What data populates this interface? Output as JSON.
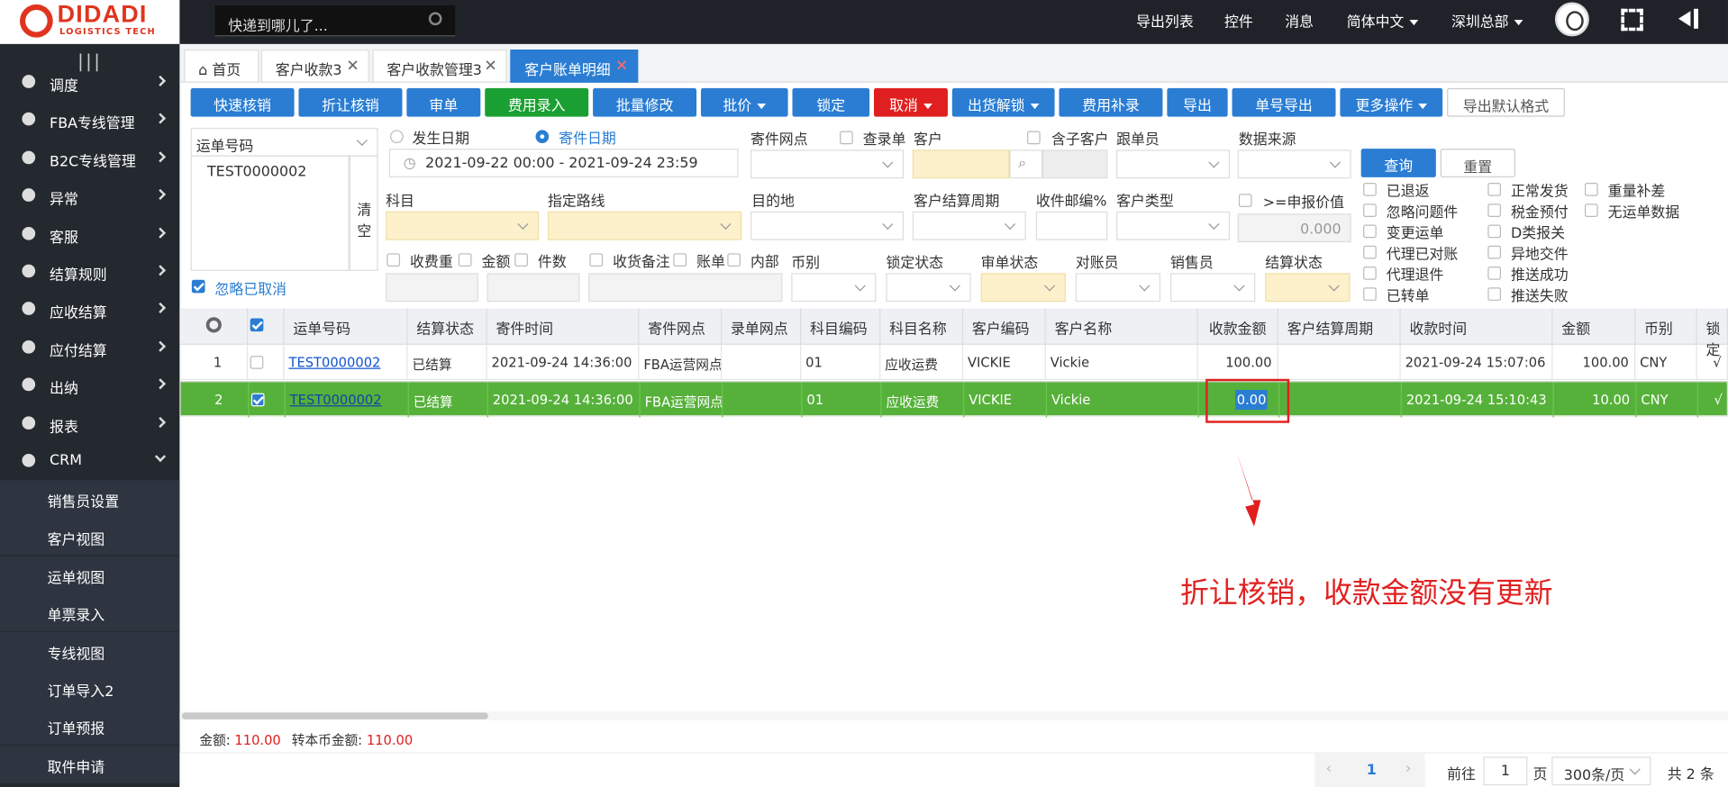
{
  "brand": {
    "name": "DIDADI",
    "tagline": "LOGISTICS TECH"
  },
  "search": {
    "placeholder": "快递到哪儿了..."
  },
  "topnav": {
    "export_list": "导出列表",
    "plugin": "控件",
    "messages": "消息",
    "language": "简体中文",
    "branch": "深圳总部"
  },
  "sidebar": {
    "items": [
      {
        "label": "调度",
        "icon": "dispatch-icon"
      },
      {
        "label": "FBA专线管理",
        "icon": "pie-icon"
      },
      {
        "label": "B2C专线管理",
        "icon": "pie-icon"
      },
      {
        "label": "异常",
        "icon": "alert-icon"
      },
      {
        "label": "客服",
        "icon": "service-icon"
      },
      {
        "label": "结算规则",
        "icon": "rule-icon"
      },
      {
        "label": "应收结算",
        "icon": "truck-icon"
      },
      {
        "label": "应付结算",
        "icon": "truck-icon"
      },
      {
        "label": "出纳",
        "icon": "user-icon"
      },
      {
        "label": "报表",
        "icon": "report-icon"
      },
      {
        "label": "CRM",
        "icon": "crm-icon"
      }
    ],
    "crm_children": [
      "销售员设置",
      "客户视图",
      "运单视图",
      "单票录入",
      "专线视图",
      "订单导入2",
      "订单预报",
      "取件申请"
    ]
  },
  "tabs": [
    {
      "label": "首页"
    },
    {
      "label": "客户收款3"
    },
    {
      "label": "客户收款管理3"
    },
    {
      "label": "客户账单明细"
    }
  ],
  "toolbar": {
    "quick_verify": "快速核销",
    "discount_verify": "折让核销",
    "audit": "审单",
    "fee_entry": "费用录入",
    "batch_edit": "批量修改",
    "price": "批价",
    "lock": "锁定",
    "cancel": "取消",
    "ship_unlock": "出货解锁",
    "fee_supplement": "费用补录",
    "export": "导出",
    "single_export": "单号导出",
    "more": "更多操作",
    "export_default": "导出默认格式"
  },
  "filters": {
    "waybill_type": "运单号码",
    "waybill_text": "TEST0000002",
    "clear": "清空",
    "ignore_cancelled": "忽略已取消",
    "occur_date": "发生日期",
    "send_date": "寄件日期",
    "date_range": "2021-09-22 00:00  -  2021-09-24 23:59",
    "send_point": "寄件网点",
    "entry_order": "查录单",
    "customer": "客户",
    "include_sub": "含子客户",
    "follower": "跟单员",
    "data_source": "数据来源",
    "query": "查询",
    "reset": "重置",
    "subject": "科目",
    "route": "指定路线",
    "destination": "目的地",
    "settle_cycle": "客户结算周期",
    "zip_pct": "收件邮编%",
    "customer_type": "客户类型",
    "declared": ">=申报价值",
    "declared_value": "0.000",
    "chk_weight": "收费重",
    "chk_amount": "金额",
    "chk_pieces": "件数",
    "chk_remark": "收货备注",
    "chk_bill": "账单",
    "chk_internal": "内部",
    "currency": "币别",
    "lock_status": "锁定状态",
    "audit_status": "审单状态",
    "reconciler": "对账员",
    "salesman": "销售员",
    "settle_status": "结算状态",
    "right_checks_a": [
      "已退返",
      "忽略问题件",
      "变更运单",
      "代理已对账",
      "代理退件",
      "已转单"
    ],
    "right_checks_b": [
      "正常发货",
      "税金预付",
      "D类报关",
      "异地交件",
      "推送成功",
      "推送失败"
    ],
    "right_checks_c": [
      "重量补差",
      "无运单数据"
    ]
  },
  "table": {
    "headers": [
      "运单号码",
      "结算状态",
      "寄件时间",
      "寄件网点",
      "录单网点",
      "科目编码",
      "科目名称",
      "客户编码",
      "客户名称",
      "收款金额",
      "客户结算周期",
      "收款时间",
      "金额",
      "币别",
      "锁定"
    ],
    "rows": [
      {
        "idx": "1",
        "waybill": "TEST0000002",
        "settle": "已结算",
        "send_time": "2021-09-24 14:36:00",
        "point": "FBA运营网点",
        "entry_point": "",
        "subject_code": "01",
        "subject_name": "应收运费",
        "cust_code": "VICKIE",
        "cust_name": "Vickie",
        "recv_amount": "100.00",
        "cycle": "",
        "recv_time": "2021-09-24 15:07:06",
        "amount": "100.00",
        "currency": "CNY",
        "lock": "√"
      },
      {
        "idx": "2",
        "waybill": "TEST0000002",
        "settle": "已结算",
        "send_time": "2021-09-24 14:36:00",
        "point": "FBA运营网点",
        "entry_point": "",
        "subject_code": "01",
        "subject_name": "应收运费",
        "cust_code": "VICKIE",
        "cust_name": "Vickie",
        "recv_amount": "0.00",
        "cycle": "",
        "recv_time": "2021-09-24 15:10:43",
        "amount": "10.00",
        "currency": "CNY",
        "lock": "√"
      }
    ]
  },
  "annotation": {
    "text": "折让核销，收款金额没有更新",
    "color": "#e02020"
  },
  "summary": {
    "amount_label": "金额:",
    "amount": "110.00",
    "base_label": "转本币金额:",
    "base_amount": "110.00"
  },
  "pager": {
    "page": "1",
    "goto_label": "前往",
    "goto_value": "1",
    "page_unit": "页",
    "page_size": "300条/页",
    "total": "共 2 条"
  }
}
